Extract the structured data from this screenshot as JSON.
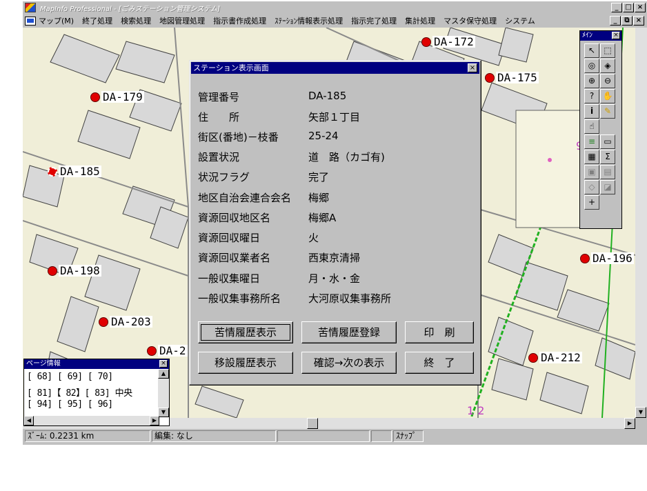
{
  "window": {
    "title": "MapInfo Professional - [ごみステーション管理システム]",
    "min": "_",
    "max": "□",
    "close": "×"
  },
  "menu": {
    "items": [
      "マップ(M)",
      "終了処理",
      "検索処理",
      "地図管理処理",
      "指示書作成処理",
      "ｽﾃｰｼｮﾝ情報表示処理",
      "指示完了処理",
      "集計処理",
      "マスタ保守処理",
      "システム"
    ],
    "win_min": "_",
    "win_restore": "⧉",
    "win_close": "×"
  },
  "map": {
    "stations": [
      "DA-172",
      "DA-175",
      "DA-179",
      "DA-185",
      "DA-198",
      "DA-196",
      "DA-203",
      "DA-2",
      "DA-212"
    ],
    "numbers": [
      "9",
      "1 2"
    ],
    "station_color": "#e00000"
  },
  "toolbox": {
    "title": "ﾒｲﾝ",
    "close": "×"
  },
  "dialog": {
    "title": "ステーション表示画面",
    "close": "×",
    "fields": [
      {
        "label": "管理番号",
        "value": "DA-185"
      },
      {
        "label": "住　　所",
        "value": "矢部１丁目"
      },
      {
        "label": "街区(番地)－枝番",
        "value": "25-24"
      },
      {
        "label": "設置状況",
        "value": "道　路（カゴ有)"
      },
      {
        "label": "状況フラグ",
        "value": "完了"
      },
      {
        "label": "地区自治会連合会名",
        "value": "梅郷"
      },
      {
        "label": "資源回収地区名",
        "value": "梅郷A"
      },
      {
        "label": "資源回収曜日",
        "value": "火"
      },
      {
        "label": "資源回収業者名",
        "value": "西東京清掃"
      },
      {
        "label": "一般収集曜日",
        "value": "月・水・金"
      },
      {
        "label": "一般収集事務所名",
        "value": "大河原収集事務所"
      }
    ],
    "buttons": {
      "complaint_history": "苦情履歴表示",
      "complaint_register": "苦情履歴登録",
      "print": "印　刷",
      "move_history": "移設履歴表示",
      "confirm_next": "確認→次の表示",
      "end": "終　了"
    }
  },
  "page_info": {
    "title": "ページ情報",
    "close": "×",
    "rows": [
      "[ 68] [ 69] [ 70]",
      "[ 81]【 82】[ 83]  中央",
      "[ 94] [ 95] [ 96]"
    ]
  },
  "status": {
    "zoom": "ｽﾞｰﾑ: 0.2231 km",
    "edit": "編集: なし",
    "snap": "ｽﾅｯﾌﾟ"
  }
}
